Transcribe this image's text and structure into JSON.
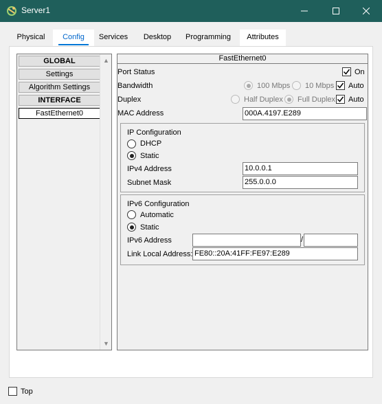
{
  "window": {
    "title": "Server1",
    "app_icon": "packet-tracer-icon",
    "controls": {
      "minimize": "minimize-icon",
      "maximize": "maximize-icon",
      "close": "close-icon"
    }
  },
  "tabs": [
    {
      "label": "Physical",
      "active": false
    },
    {
      "label": "Config",
      "active": true
    },
    {
      "label": "Services",
      "active": false
    },
    {
      "label": "Desktop",
      "active": false
    },
    {
      "label": "Programming",
      "active": false
    },
    {
      "label": "Attributes",
      "active": false
    }
  ],
  "left_nav": {
    "items": [
      {
        "label": "GLOBAL",
        "type": "header"
      },
      {
        "label": "Settings",
        "type": "item"
      },
      {
        "label": "Algorithm Settings",
        "type": "item"
      },
      {
        "label": "INTERFACE",
        "type": "header"
      },
      {
        "label": "FastEthernet0",
        "type": "item",
        "selected": true
      }
    ]
  },
  "interface": {
    "title": "FastEthernet0",
    "port_status": {
      "label": "Port Status",
      "on_label": "On",
      "on_checked": true
    },
    "bandwidth": {
      "label": "Bandwidth",
      "opt1": "100 Mbps",
      "opt2": "10 Mbps",
      "auto_label": "Auto",
      "auto_checked": true
    },
    "duplex": {
      "label": "Duplex",
      "opt1": "Half Duplex",
      "opt2": "Full Duplex",
      "auto_label": "Auto",
      "auto_checked": true
    },
    "mac": {
      "label": "MAC Address",
      "value": "000A.4197.E289"
    },
    "ip_config": {
      "title": "IP Configuration",
      "dhcp_label": "DHCP",
      "static_label": "Static",
      "mode": "Static",
      "ipv4_label": "IPv4 Address",
      "ipv4_value": "10.0.0.1",
      "subnet_label": "Subnet Mask",
      "subnet_value": "255.0.0.0"
    },
    "ipv6_config": {
      "title": "IPv6 Configuration",
      "automatic_label": "Automatic",
      "static_label": "Static",
      "mode": "Static",
      "ipv6_label": "IPv6 Address",
      "ipv6_value": "",
      "prefix_sep": "/",
      "prefix_value": "",
      "link_local_label": "Link Local Address:",
      "link_local_value": "FE80::20A:41FF:FE97:E289"
    }
  },
  "footer": {
    "top_label": "Top",
    "top_checked": false
  }
}
